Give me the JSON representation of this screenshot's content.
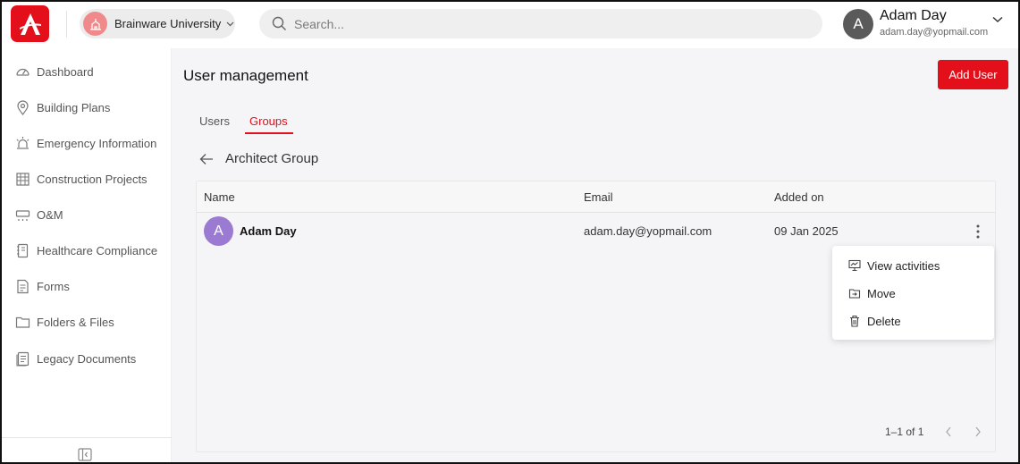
{
  "header": {
    "org": {
      "name": "Brainware University"
    },
    "search": {
      "placeholder": "Search..."
    },
    "user": {
      "initial": "A",
      "name": "Adam Day",
      "email": "adam.day@yopmail.com"
    }
  },
  "sidebar": {
    "items": [
      {
        "label": "Dashboard",
        "icon": "dashboard-icon"
      },
      {
        "label": "Building Plans",
        "icon": "location-pin-icon"
      },
      {
        "label": "Emergency Information",
        "icon": "siren-icon"
      },
      {
        "label": "Construction Projects",
        "icon": "construction-icon"
      },
      {
        "label": "O&M",
        "icon": "air-conditioner-icon"
      },
      {
        "label": "Healthcare Compliance",
        "icon": "notebook-icon"
      },
      {
        "label": "Forms",
        "icon": "form-icon"
      },
      {
        "label": "Folders & Files",
        "icon": "folder-icon"
      },
      {
        "label": "Legacy Documents",
        "icon": "documents-icon"
      }
    ]
  },
  "main": {
    "title": "User management",
    "add_user_label": "Add User",
    "tabs": [
      {
        "label": "Users",
        "active": false
      },
      {
        "label": "Groups",
        "active": true
      }
    ],
    "group_title": "Architect Group",
    "table": {
      "columns": [
        "Name",
        "Email",
        "Added on"
      ],
      "rows": [
        {
          "initial": "A",
          "name": "Adam Day",
          "email": "adam.day@yopmail.com",
          "added_on": "09 Jan 2025"
        }
      ]
    },
    "row_menu": {
      "items": [
        {
          "label": "View activities",
          "icon": "activity-icon"
        },
        {
          "label": "Move",
          "icon": "move-icon"
        },
        {
          "label": "Delete",
          "icon": "trash-icon"
        }
      ]
    },
    "pagination": {
      "text": "1–1 of 1"
    }
  },
  "colors": {
    "brand": "#e3101b",
    "row_avatar": "#9b7ad1",
    "user_avatar": "#5a5a5a",
    "org_avatar": "#f08a8a"
  }
}
